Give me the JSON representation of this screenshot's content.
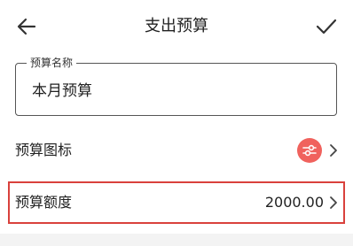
{
  "header": {
    "title": "支出预算",
    "back_icon": "arrow-left-icon",
    "confirm_icon": "check-icon"
  },
  "budget_name": {
    "legend": "预算名称",
    "value": "本月预算"
  },
  "budget_icon_row": {
    "label": "预算图标",
    "icon": "sliders-icon",
    "icon_bg_color": "#f0625d"
  },
  "budget_amount_row": {
    "label": "预算额度",
    "value": "2000.00",
    "highlight_color": "#d9413c"
  }
}
